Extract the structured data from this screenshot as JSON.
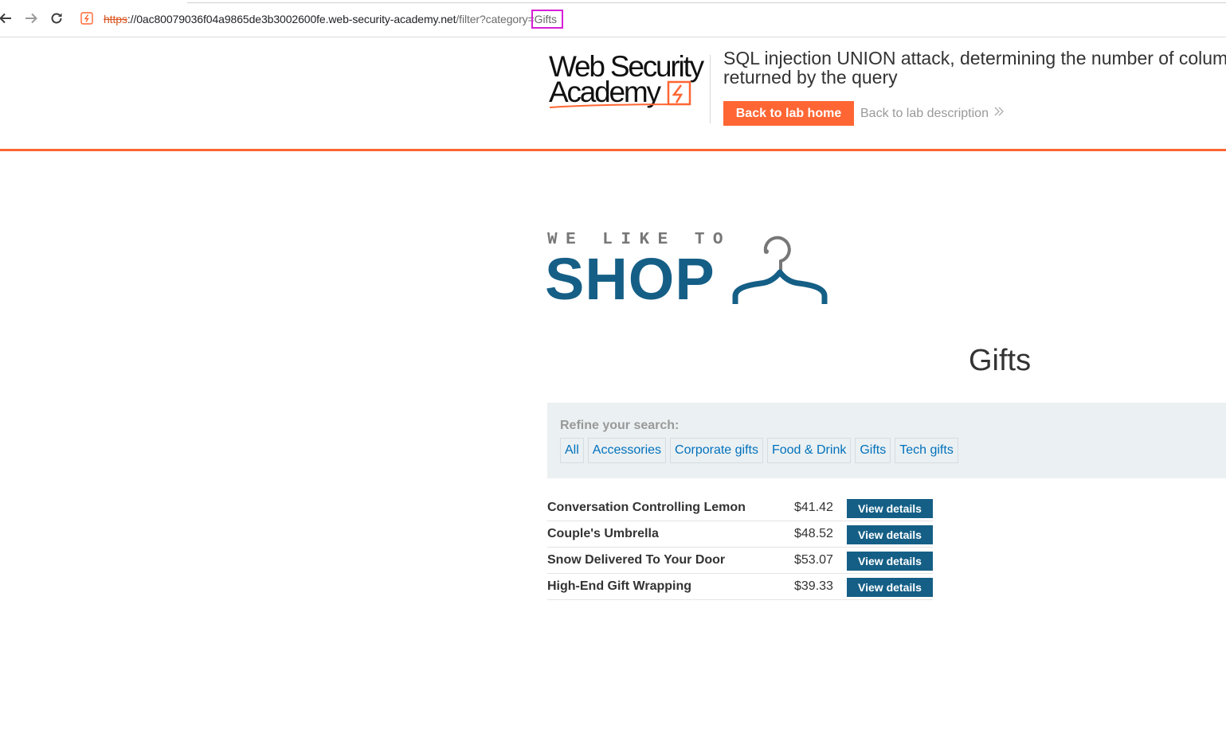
{
  "browser": {
    "url_scheme": "https",
    "url_host": "://0ac80079036f04a9865de3b3002600fe.web-security-academy.net",
    "url_path": "/filter?category=",
    "url_highlight": "Gifts",
    "icons": {
      "back": "arrow-left-icon",
      "forward": "arrow-right-icon",
      "reload": "reload-icon",
      "site": "lightning-site-icon"
    },
    "highlight_color": "#d61fd6"
  },
  "banner": {
    "logo_line1": "Web Security",
    "logo_line2": "Academy",
    "lab_title_line1": "SQL injection UNION attack, determining the number of columns",
    "lab_title_line2": "returned by the query",
    "back_home_label": "Back to lab home",
    "back_description_label": "Back to lab description",
    "accent_color": "#ff6633"
  },
  "shop": {
    "tagline": "WE LIKE TO",
    "name": "SHOP",
    "brand_color": "#155f86"
  },
  "category_heading": "Gifts",
  "filters": {
    "label": "Refine your search:",
    "categories": [
      "All",
      "Accessories",
      "Corporate gifts",
      "Food & Drink",
      "Gifts",
      "Tech gifts"
    ]
  },
  "products": [
    {
      "name": "Conversation Controlling Lemon",
      "price": "$41.42",
      "action": "View details"
    },
    {
      "name": "Couple's Umbrella",
      "price": "$48.52",
      "action": "View details"
    },
    {
      "name": "Snow Delivered To Your Door",
      "price": "$53.07",
      "action": "View details"
    },
    {
      "name": "High-End Gift Wrapping",
      "price": "$39.33",
      "action": "View details"
    }
  ]
}
